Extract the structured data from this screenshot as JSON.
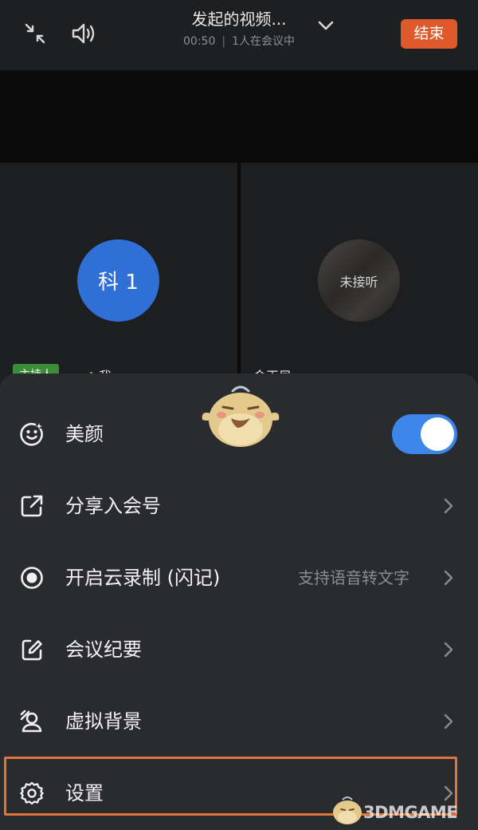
{
  "header": {
    "title": "发起的视频...",
    "duration": "00:50",
    "participants": "1人在会议中",
    "end_label": "结束"
  },
  "tiles": {
    "self": {
      "avatar_text": "科 1",
      "host_tag": "主持人",
      "name": "我"
    },
    "other": {
      "status": "未接听",
      "name": "金玉凤"
    }
  },
  "menu": {
    "beauty": {
      "label": "美颜",
      "enabled": true
    },
    "share": {
      "label": "分享入会号"
    },
    "record": {
      "label": "开启云录制 (闪记)",
      "hint": "支持语音转文字"
    },
    "minutes": {
      "label": "会议纪要"
    },
    "background": {
      "label": "虚拟背景"
    },
    "settings": {
      "label": "设置"
    }
  },
  "watermark": {
    "text": "3DMGAME"
  },
  "colors": {
    "accent": "#3d86e9",
    "end": "#df5a2b",
    "highlight": "#e0743a",
    "host_tag": "#3c8d3a"
  }
}
